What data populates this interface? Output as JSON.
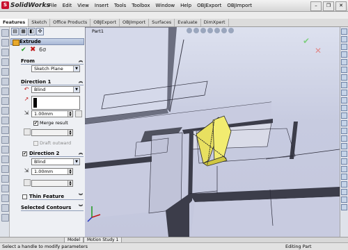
{
  "app": {
    "logo_text": "SolidWorks"
  },
  "menu": [
    "File",
    "Edit",
    "View",
    "Insert",
    "Tools",
    "Toolbox",
    "Window",
    "Help",
    "OBJExport",
    "OBJImport"
  ],
  "command_tabs": [
    "Features",
    "Sketch",
    "Office Products",
    "OBJExport",
    "OBJImport",
    "Surfaces",
    "Evaluate",
    "DimXpert"
  ],
  "active_tab": "Features",
  "property_manager": {
    "title": "Extrude",
    "from": {
      "header": "From",
      "value": "Sketch Plane"
    },
    "direction1": {
      "header": "Direction 1",
      "end_condition": "Blind",
      "depth": "1.00mm",
      "merge_result_label": "Merge result",
      "merge_result_checked": true,
      "draft_label": "Draft outward"
    },
    "direction2": {
      "header": "Direction 2",
      "checked": true,
      "end_condition": "Blind",
      "depth": "1.00mm"
    },
    "thin_feature": {
      "header": "Thin Feature"
    },
    "selected_contours": {
      "header": "Selected Contours"
    }
  },
  "viewport": {
    "part_label": "Part1"
  },
  "bottom_tabs": [
    "Model",
    "Motion Study 1"
  ],
  "status": {
    "left": "Select a handle to modify parameters",
    "right": "Editing Part"
  },
  "colors": {
    "accent": "#e6e23a",
    "ok": "#1a9a1a",
    "cancel": "#c01515",
    "model_face": "#b4b8d2",
    "model_edge": "#4a4a58"
  }
}
